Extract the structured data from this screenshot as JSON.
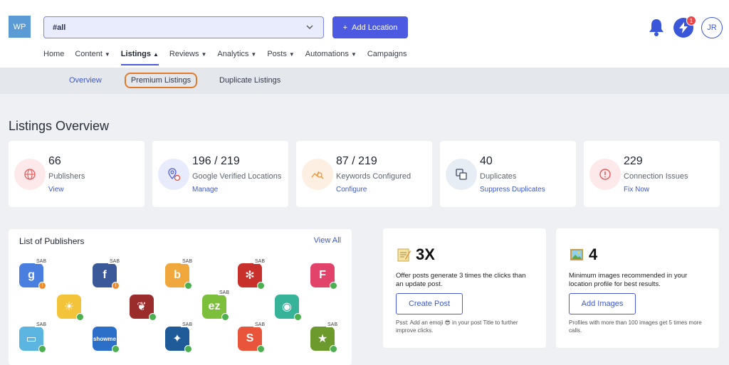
{
  "app": {
    "logo": "WP"
  },
  "header": {
    "location_select": "#all",
    "add_location": "Add Location",
    "notification_count": "1",
    "avatar": "JR"
  },
  "nav": {
    "items": [
      {
        "label": "Home",
        "caret": false,
        "active": false
      },
      {
        "label": "Content",
        "caret": true,
        "active": false
      },
      {
        "label": "Listings",
        "caret": true,
        "active": true
      },
      {
        "label": "Reviews",
        "caret": true,
        "active": false
      },
      {
        "label": "Analytics",
        "caret": true,
        "active": false
      },
      {
        "label": "Posts",
        "caret": true,
        "active": false
      },
      {
        "label": "Automations",
        "caret": true,
        "active": false
      },
      {
        "label": "Campaigns",
        "caret": false,
        "active": false
      }
    ]
  },
  "subnav": {
    "overview": "Overview",
    "premium": "Premium Listings",
    "duplicates": "Duplicate Listings"
  },
  "overview": {
    "title": "Listings Overview",
    "cards": [
      {
        "value": "66",
        "label": "Publishers",
        "link": "View",
        "icon": "globe-icon",
        "color": "#e35b5b",
        "bg": "#fde9ea"
      },
      {
        "value": "196 / 219",
        "label": "Google Verified Locations",
        "link": "Manage",
        "icon": "location-pin-icon",
        "color": "#4b5ae0",
        "bg": "#e8ebfb"
      },
      {
        "value": "87 / 219",
        "label": "Keywords Configured",
        "link": "Configure",
        "icon": "keyword-search-icon",
        "color": "#e8963a",
        "bg": "#fdf0e2"
      },
      {
        "value": "40",
        "label": "Duplicates",
        "link": "Suppress Duplicates",
        "icon": "duplicate-icon",
        "color": "#3f4a5a",
        "bg": "#e6edf5"
      },
      {
        "value": "229",
        "label": "Connection Issues",
        "link": "Fix Now",
        "icon": "alert-circle-icon",
        "color": "#e35b5b",
        "bg": "#fde9ea"
      }
    ]
  },
  "publishers": {
    "title": "List of Publishers",
    "view_all": "View All",
    "sab": "SAB",
    "tiles": [
      {
        "name": "google",
        "glyph": "g",
        "bg": "#4a7fe0",
        "sab": true,
        "status": "warn"
      },
      {
        "name": "facebook",
        "glyph": "f",
        "bg": "#3b5998",
        "sab": true,
        "status": "warn"
      },
      {
        "name": "bing",
        "glyph": "b",
        "bg": "#f0a73c",
        "sab": true,
        "status": "ok"
      },
      {
        "name": "yelp",
        "glyph": "✻",
        "bg": "#c8302c",
        "sab": true,
        "status": "ok"
      },
      {
        "name": "foursquare",
        "glyph": "F",
        "bg": "#e2436a",
        "sab": false,
        "status": "ok"
      },
      {
        "name": "sun-app",
        "glyph": "☀",
        "bg": "#f3c33a",
        "sab": false,
        "status": "ok"
      },
      {
        "name": "leaf-app",
        "glyph": "❦",
        "bg": "#9b2c2c",
        "sab": false,
        "status": "ok"
      },
      {
        "name": "ezlocal",
        "glyph": "ez",
        "bg": "#7cbf3b",
        "sab": true,
        "status": "ok"
      },
      {
        "name": "pin-app",
        "glyph": "◉",
        "bg": "#37b39a",
        "sab": false,
        "status": "ok"
      },
      {
        "name": "chat-app",
        "glyph": "▭",
        "bg": "#5bb5e0",
        "sab": true,
        "status": "ok"
      },
      {
        "name": "showmelocal",
        "glyph": "showme",
        "bg": "#2c6fc9",
        "sab": false,
        "status": "ok"
      },
      {
        "name": "gift-app",
        "glyph": "✦",
        "bg": "#1f5a99",
        "sab": true,
        "status": "ok"
      },
      {
        "name": "s-app",
        "glyph": "S",
        "bg": "#e8553a",
        "sab": true,
        "status": "ok"
      },
      {
        "name": "star-app",
        "glyph": "★",
        "bg": "#6c9a2d",
        "sab": true,
        "status": "ok"
      }
    ]
  },
  "tips": [
    {
      "headline": "3X",
      "emoji": "memo-icon",
      "text_lines": [
        "Offer posts generate 3 times the clicks than",
        "an update post."
      ],
      "button": "Create Post",
      "note_lines": [
        "Psst: Add an emoji 😎 in your post Title to further",
        "improve clicks."
      ]
    },
    {
      "headline": "4",
      "emoji": "picture-icon",
      "text_lines": [
        "Minimum images recommended in your",
        "location profile for best results."
      ],
      "button": "Add Images",
      "note_lines": [
        "Profiles with more than 100 images get 5 times more",
        "calls."
      ]
    }
  ]
}
